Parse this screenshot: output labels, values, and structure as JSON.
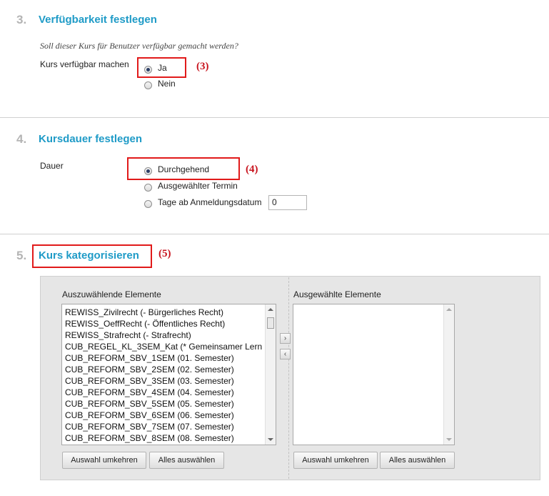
{
  "section3": {
    "number": "3.",
    "title": "Verfügbarkeit festlegen",
    "question": "Soll dieser Kurs für Benutzer verfügbar gemacht werden?",
    "field_label": "Kurs verfügbar machen",
    "options": [
      "Ja",
      "Nein"
    ],
    "selected": "Ja",
    "annotation": "(3)"
  },
  "section4": {
    "number": "4.",
    "title": "Kursdauer festlegen",
    "field_label": "Dauer",
    "options": [
      "Durchgehend",
      "Ausgewählter Termin",
      "Tage ab Anmeldungsdatum"
    ],
    "selected": "Durchgehend",
    "days_value": "0",
    "annotation": "(4)"
  },
  "section5": {
    "number": "5.",
    "title": "Kurs kategorisieren",
    "annotation": "(5)",
    "available": {
      "header": "Auszuwählende Elemente",
      "items": [
        "REWISS_Zivilrecht (- Bürgerliches Recht)",
        "REWISS_OeffRecht (- Öffentliches Recht)",
        "REWISS_Strafrecht (- Strafrecht)",
        "CUB_REGEL_KL_3SEM_Kat (* Gemeinsamer Lern",
        "CUB_REFORM_SBV_1SEM (01. Semester)",
        "CUB_REFORM_SBV_2SEM (02. Semester)",
        "CUB_REFORM_SBV_3SEM (03. Semester)",
        "CUB_REFORM_SBV_4SEM (04. Semester)",
        "CUB_REFORM_SBV_5SEM (05. Semester)",
        "CUB_REFORM_SBV_6SEM (06. Semester)",
        "CUB_REFORM_SBV_7SEM (07. Semester)",
        "CUB_REFORM_SBV_8SEM (08. Semester)"
      ],
      "invert_label": "Auswahl umkehren",
      "select_all_label": "Alles auswählen"
    },
    "selected": {
      "header": "Ausgewählte Elemente",
      "items": [],
      "invert_label": "Auswahl umkehren",
      "select_all_label": "Alles auswählen"
    },
    "move_right_icon": "chevron-right-icon",
    "move_left_icon": "chevron-left-icon"
  },
  "colors": {
    "section_title": "#1f9bc7",
    "section_number": "#b4b4b4",
    "annotation_red": "#c8141e"
  }
}
